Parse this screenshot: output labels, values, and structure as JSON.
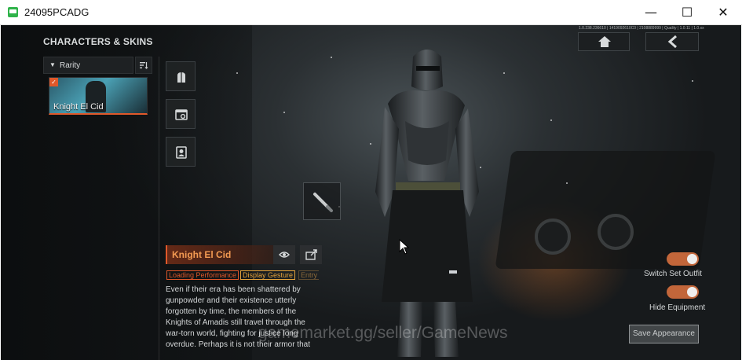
{
  "window": {
    "title": "24095PCADG",
    "minimize": "—",
    "maximize": "☐",
    "close": "✕"
  },
  "panel": {
    "title": "CHARACTERS & SKINS",
    "filter_label": "Rarity",
    "sort_icon": "sort-icon",
    "skins": [
      {
        "name": "Knight El Cid",
        "selected": true
      }
    ],
    "categories": [
      "outfit-icon",
      "wardrobe-icon",
      "profile-card-icon"
    ]
  },
  "top_nav": {
    "build_info": "1.0.238.236610 | 1419092610C0 | 2108889999 | Quality | 1.0.11 | 1.0.xx",
    "home_icon": "home-icon",
    "back_icon": "back-arrow-icon"
  },
  "skin": {
    "name": "Knight El Cid",
    "tags": [
      "Loading Performance",
      "Display Gesture",
      "Entry"
    ],
    "description": "Even if their era has been shattered by gunpowder and their existence utterly forgotten by time, the members of the Knights of Amadis still travel through the war-torn world, fighting for justice long overdue. Perhaps it is not their armor that"
  },
  "controls": {
    "switch_set_outfit": {
      "label": "Switch Set Outfit",
      "on": true
    },
    "hide_equipment": {
      "label": "Hide Equipment",
      "on": true
    },
    "save_label": "Save Appearance"
  },
  "overlay": {
    "watermark": "gamemarket.gg/seller/GameNews"
  },
  "colors": {
    "accent": "#e0582a",
    "gesture_tag": "#e5a33c",
    "toggle_on": "#c2663a"
  }
}
